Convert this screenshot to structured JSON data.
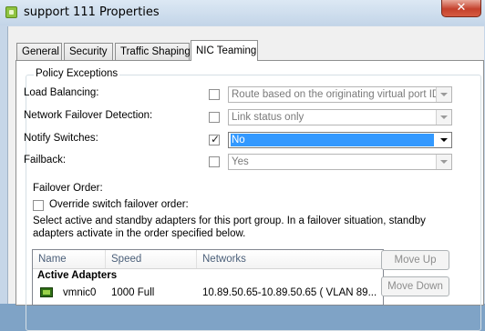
{
  "window": {
    "title": "support 111 Properties",
    "icon": "vm-portgroup-icon",
    "close_glyph": "✕"
  },
  "tabs": [
    {
      "label": "General",
      "active": false
    },
    {
      "label": "Security",
      "active": false
    },
    {
      "label": "Traffic Shaping",
      "active": false
    },
    {
      "label": "NIC Teaming",
      "active": true
    }
  ],
  "policy_exceptions": {
    "legend": "Policy Exceptions",
    "rows": [
      {
        "label": "Load Balancing:",
        "checked": false,
        "value": "Route based on the originating virtual port ID",
        "enabled": false
      },
      {
        "label": "Network Failover Detection:",
        "checked": false,
        "value": "Link status only",
        "enabled": false
      },
      {
        "label": "Notify Switches:",
        "checked": true,
        "value": "No",
        "enabled": true
      },
      {
        "label": "Failback:",
        "checked": false,
        "value": "Yes",
        "enabled": false
      }
    ],
    "failover_order_label": "Failover Order:",
    "override_label": "Override switch failover order:",
    "override_checked": false,
    "description": "Select active and standby adapters for this port group.  In a failover situation, standby",
    "description_line2": "adapters activate  in the order specified below."
  },
  "adapters_table": {
    "columns": [
      "Name",
      "Speed",
      "Networks"
    ],
    "group_label": "Active Adapters",
    "rows": [
      {
        "name": "vmnic0",
        "speed": "1000 Full",
        "networks": "10.89.50.65-10.89.50.65 ( VLAN 89..."
      }
    ]
  },
  "buttons": {
    "move_up": "Move Up",
    "move_down": "Move Down"
  },
  "colors": {
    "selection": "#3399ff",
    "header_text": "#4c607a",
    "close_button": "#c5412c"
  },
  "check_glyph": "✓"
}
